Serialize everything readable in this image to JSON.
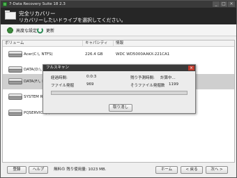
{
  "window": {
    "title": "7-Data Recovery Suite 18 2.3",
    "minimize": "_",
    "maximize": "□",
    "close": "×"
  },
  "header": {
    "title": "完全リカバリー",
    "subtitle": "リカバリーしたいドライブを選択してください。"
  },
  "toolbar": {
    "advanced_label": "高度な設定",
    "refresh_label": "更新"
  },
  "table": {
    "columns": [
      "ボリューム",
      "キャパシティ",
      "情報"
    ],
    "rows": [
      {
        "volume": "Acer(C:\\, NTFS)",
        "capacity": "226.4 GB",
        "info": "WDC WD5000AAKX-221CA1"
      },
      {
        "volume": "DATA(D:\\, NTF",
        "capacity": "",
        "info": ""
      },
      {
        "volume": "DATA(F:\\, NTF",
        "capacity": "",
        "info": ""
      },
      {
        "volume": "SYSTEM RESER",
        "capacity": "",
        "info": ""
      },
      {
        "volume": "PQSERVICE(*,",
        "capacity": "",
        "info": ""
      }
    ]
  },
  "dialog": {
    "title": "フルスキャン",
    "close": "×",
    "elapsed_label": "経過時間:",
    "elapsed_value": "0:0:3",
    "remaining_label": "残り予測時間:",
    "remaining_value": "計算中...",
    "files_found_label": "ファイル発掘",
    "files_found_value": "969",
    "total_files_label": "そうファイル発掘数",
    "total_files_value": "1199",
    "progress": 0.0,
    "cancel_label": "取り消し"
  },
  "footer": {
    "settings_label": "登録",
    "help_label": "ヘルプ",
    "status_text": "無料の 残り使用量: 1023 MB.",
    "home_label": "ホーム",
    "back_label": "< 戻る",
    "next_label": "次へ >"
  },
  "colors": {
    "header_bg": "#262626",
    "accent_green": "#3c9a3c",
    "selected_row": "#cfcfcf"
  }
}
